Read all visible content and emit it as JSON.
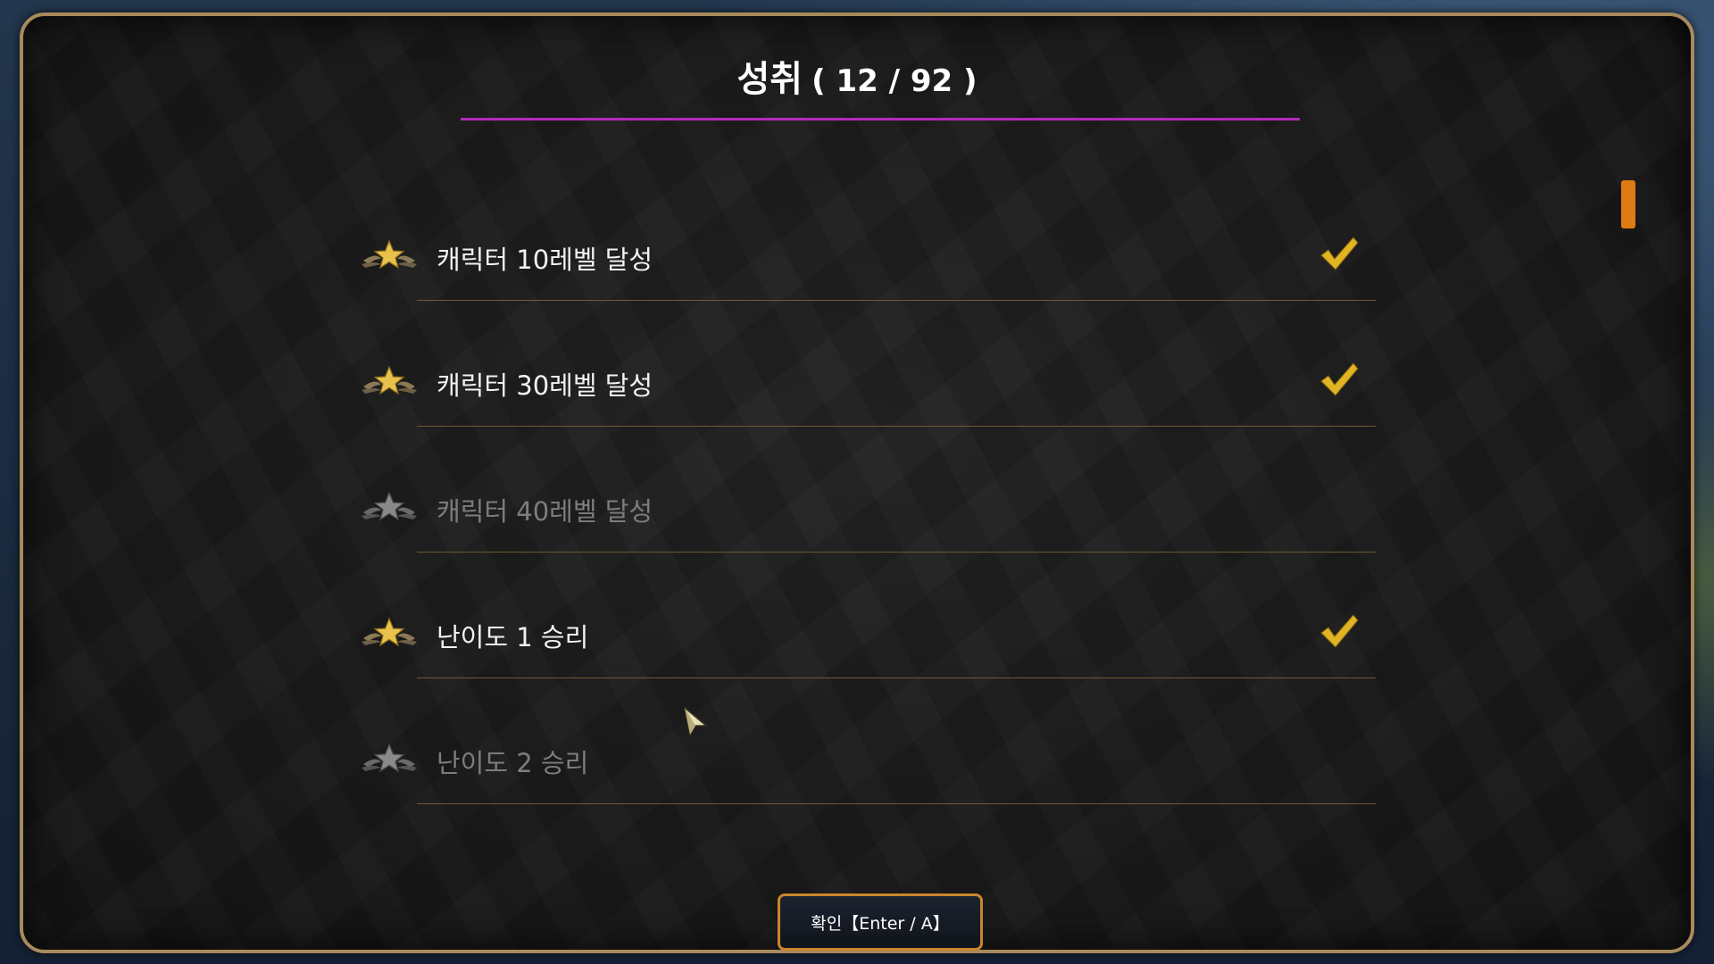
{
  "panel": {
    "title": "성취",
    "count": "( 12 / 92 )"
  },
  "achievements": [
    {
      "label": "캐릭터 10레벨 달성",
      "completed": true
    },
    {
      "label": "캐릭터 30레벨 달성",
      "completed": true
    },
    {
      "label": "캐릭터 40레벨 달성",
      "completed": false
    },
    {
      "label": "난이도 1 승리",
      "completed": true
    },
    {
      "label": "난이도 2 승리",
      "completed": false
    }
  ],
  "confirm_button": {
    "label": "확인【Enter / A】"
  },
  "colors": {
    "panel_border": "#a88a5c",
    "title_underline": "#b32bb8",
    "check": "#e0b422",
    "star_gold": "#e8c24a",
    "star_gray": "#8a8a8a",
    "scroll_thumb": "#e07a15",
    "button_border": "#c9862a"
  },
  "icons": {
    "achievement": "winged-star-icon",
    "completed": "checkmark-icon",
    "cursor": "pointer-cursor-icon"
  }
}
